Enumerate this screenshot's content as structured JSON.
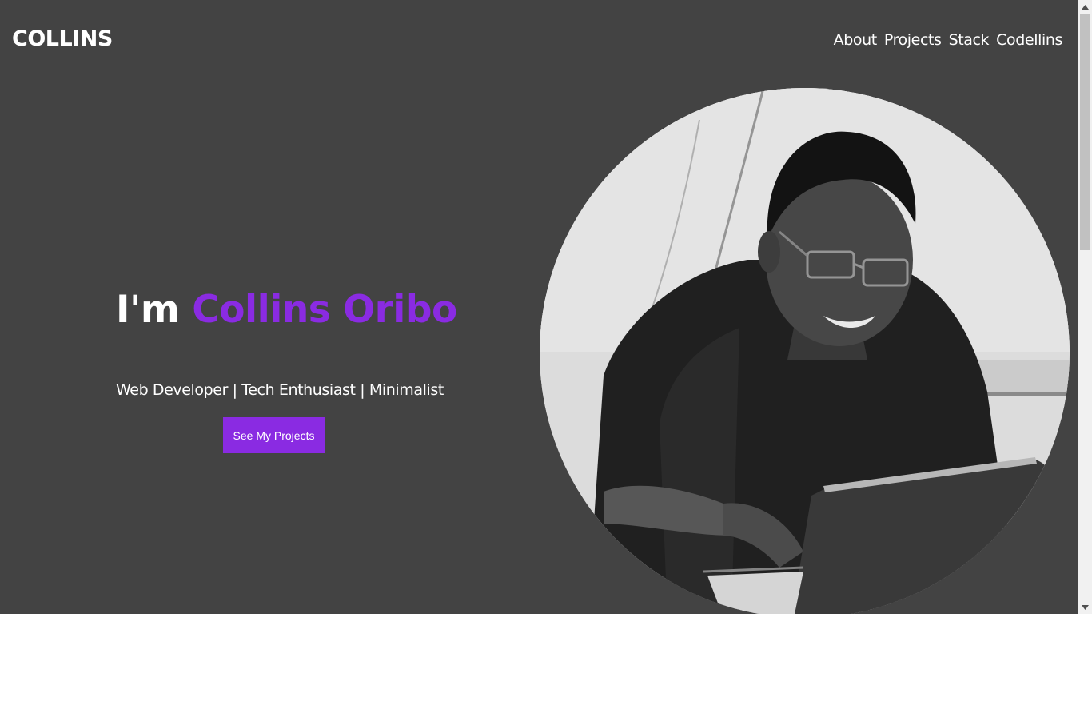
{
  "header": {
    "logo": "COLLINS",
    "nav": [
      {
        "label": "About"
      },
      {
        "label": "Projects"
      },
      {
        "label": "Stack"
      },
      {
        "label": "Codellins"
      }
    ]
  },
  "hero": {
    "greeting": "I'm ",
    "name": "Collins Oribo",
    "tagline": "Web Developer | Tech Enthusiast | Minimalist",
    "cta_label": "See My Projects"
  },
  "colors": {
    "background": "#434343",
    "accent": "#8a2be2",
    "text": "#ffffff"
  },
  "icons": {
    "scroll_up": "triangle-up-icon",
    "scroll_down": "triangle-down-icon"
  }
}
